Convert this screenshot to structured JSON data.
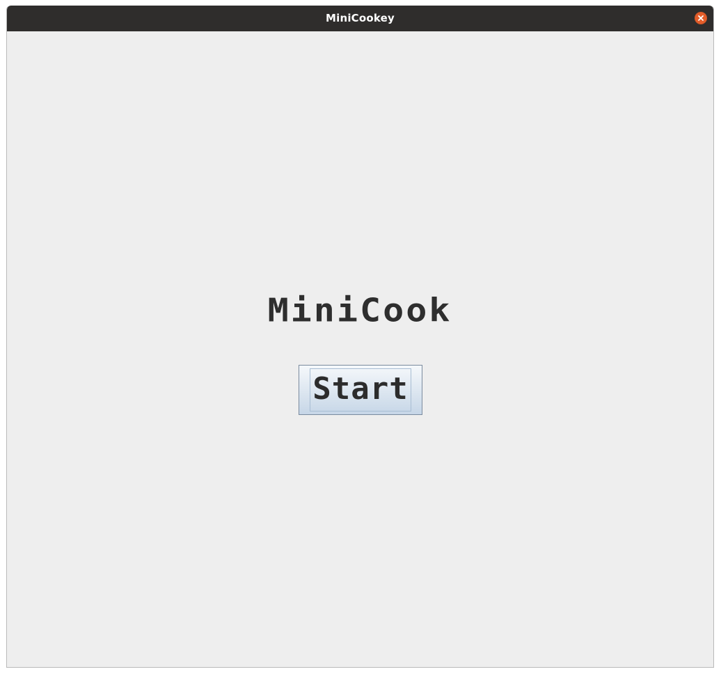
{
  "window": {
    "title": "MiniCookey",
    "close_icon": "close-icon",
    "close_color": "#e35d2a",
    "titlebar_color": "#2f2d2c",
    "background_color": "#eeeeee"
  },
  "main": {
    "game_title": "MiniCook",
    "start_button_label": "Start"
  }
}
